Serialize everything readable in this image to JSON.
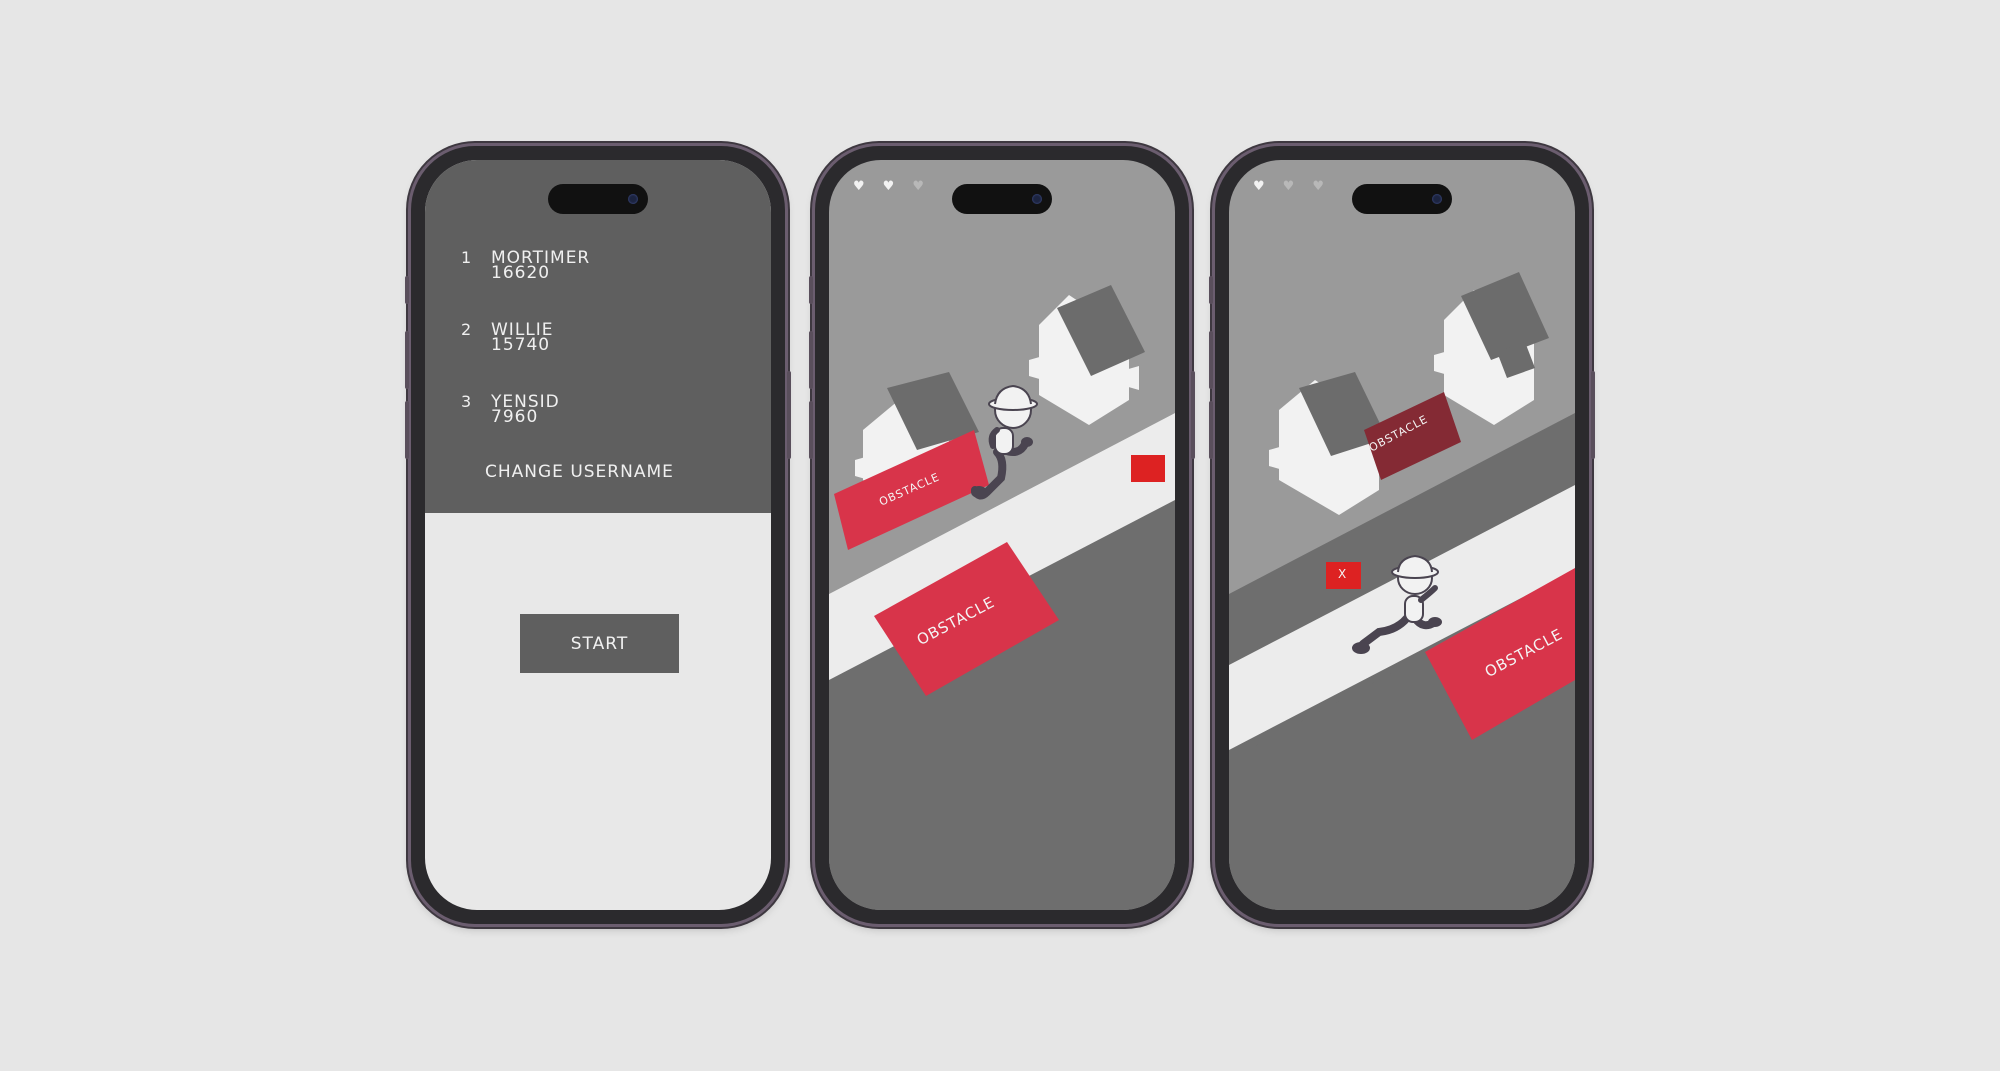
{
  "colors": {
    "background": "#e6e6e6",
    "panel_dark": "#5f5f5f",
    "panel_light": "#e8e8e8",
    "obstacle_red": "#d8344a",
    "obstacle_dark_red": "#842a34",
    "collectible_red": "#dd2222",
    "game_sky": "#9a9a9a",
    "road_dark": "#6e6e6e",
    "sidewalk": "#ececec"
  },
  "screen_menu": {
    "leaderboard": [
      {
        "rank": "1",
        "name": "MORTIMER",
        "score": "16620"
      },
      {
        "rank": "2",
        "name": "WILLIE",
        "score": "15740"
      },
      {
        "rank": "3",
        "name": "YENSID",
        "score": "7960"
      }
    ],
    "change_username_label": "CHANGE USERNAME",
    "start_label": "START"
  },
  "screen_game_1": {
    "lives": {
      "remaining": 2,
      "total": 3
    },
    "heart_full_icon": "♥",
    "heart_empty_icon": "♥",
    "obstacle_labels": [
      "OBSTACLE",
      "OBSTACLE"
    ]
  },
  "screen_game_2": {
    "lives": {
      "remaining": 1,
      "total": 3
    },
    "heart_full_icon": "♥",
    "heart_empty_icon": "♥",
    "obstacle_labels": [
      "OBSTACLE",
      "OBSTACLE"
    ],
    "collectible_label": "X"
  }
}
